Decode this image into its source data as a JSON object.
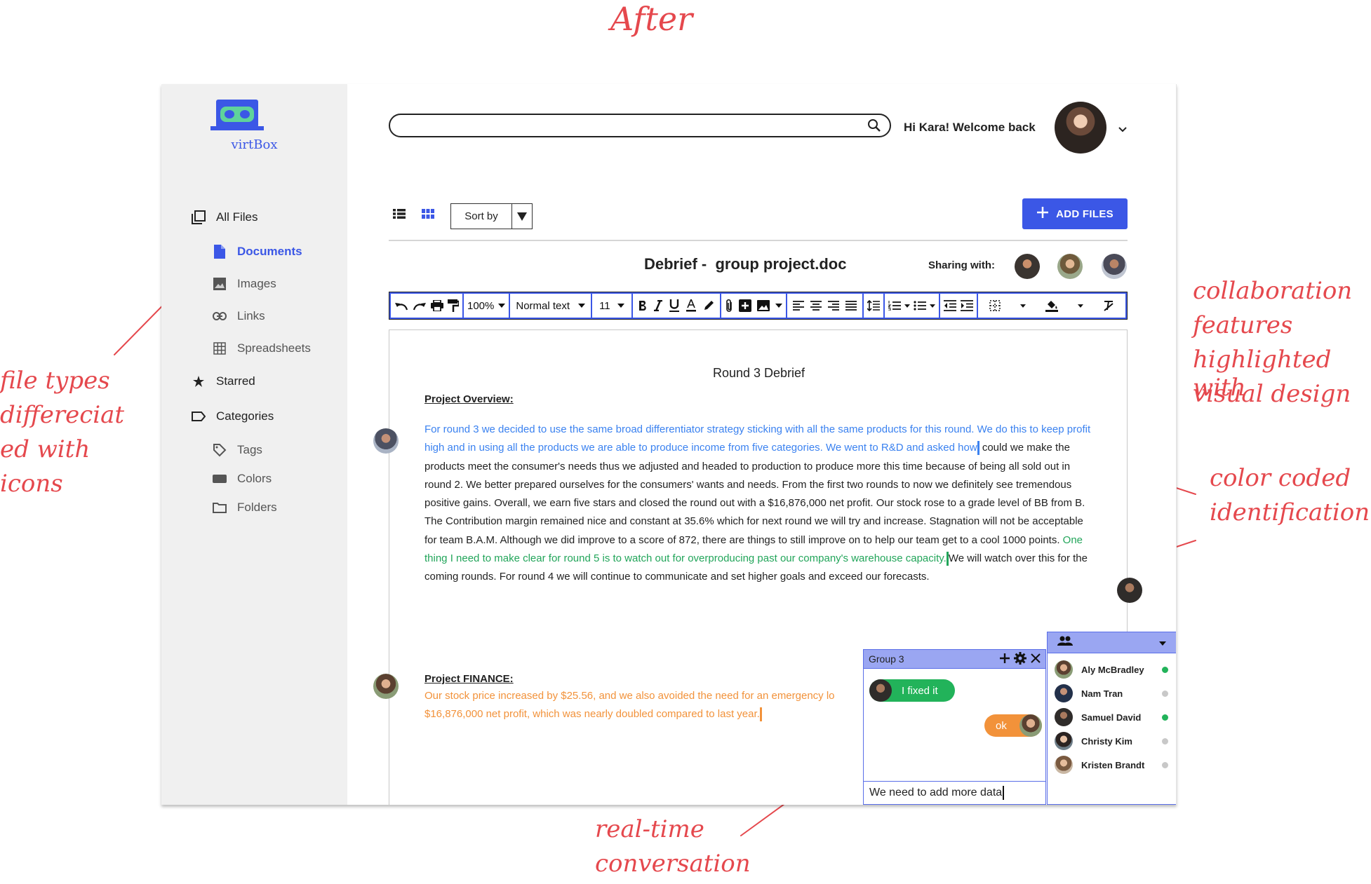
{
  "annotations": {
    "title": "After",
    "file_types": [
      "file types",
      "differeciat",
      "ed with",
      "icons"
    ],
    "collaboration": [
      "collaboration",
      "features",
      "highlighted with",
      "visual design"
    ],
    "color_coded": [
      "color coded",
      "identification"
    ],
    "realtime": [
      "real-time",
      "conversation"
    ]
  },
  "brand": {
    "name": "virtBox",
    "accent": "#3b57e6"
  },
  "sidebar": {
    "all_files": "All Files",
    "documents": "Documents",
    "images": "Images",
    "links": "Links",
    "spreadsheets": "Spreadsheets",
    "starred": "Starred",
    "categories": "Categories",
    "tags": "Tags",
    "colors": "Colors",
    "folders": "Folders"
  },
  "header": {
    "search_placeholder": "",
    "greeting": "Hi Kara! Welcome back"
  },
  "toolbar": {
    "sort_label": "Sort by",
    "add_files": "ADD FILES"
  },
  "document": {
    "title": "Debrief -  group project.doc",
    "sharing_label": "Sharing with:",
    "editor": {
      "zoom": "100%",
      "style": "Normal text",
      "font_size": "11"
    },
    "heading": "Round 3 Debrief",
    "overview_heading": "Project Overview:",
    "overview_blue": "For round 3 we decided to use the same broad differentiator strategy sticking with all the same products for this round. We do this to keep profit high and in using all the products we are able to produce income from five categories. We went to R&D and asked how",
    "overview_plain": " could we make the products meet the consumer's needs thus we adjusted and headed to production to produce more this time because of being all sold out in round 2. We better prepared ourselves for the consumers' wants and needs. From the first two rounds to now we definitely see tremendous positive gains. Overall, we earn five stars and closed the round out with a $16,876,000 net profit. Our stock rose to a grade level of BB from B. The Contribution margin remained nice and constant at 35.6% which for next round we will try and increase. Stagnation will not be acceptable for team B.A.M. Although we did improve to a score of 872, there are things to still improve on to help our team get to a cool 1000 points. ",
    "overview_green": "One thing I need to make clear for round 5 is to watch out for overproducing past our company's warehouse capacity.",
    "overview_tail": "We will watch over this for the coming rounds. For round 4 we will continue to communicate and set higher goals and exceed our forecasts.",
    "finance_heading": "Project FINANCE:",
    "finance_orange_1": "Our stock price increased by $25.56, and we also avoided the need for an emergency lo",
    "finance_orange_2": "$16,876,000 net profit, which was nearly doubled compared to last year."
  },
  "chat": {
    "title": "Group 3",
    "msg_1": "I fixed it",
    "msg_2": "ok",
    "input_value": "We need to add more data"
  },
  "members": [
    {
      "name": "Aly McBradley",
      "online": true
    },
    {
      "name": "Nam Tran",
      "online": false
    },
    {
      "name": "Samuel David",
      "online": true
    },
    {
      "name": "Christy Kim",
      "online": false
    },
    {
      "name": "Kristen Brandt",
      "online": false
    }
  ],
  "colors": {
    "online": "#22b35a",
    "offline": "#c8c8c8",
    "blue_author": "#3b82f0",
    "green_author": "#22a55a",
    "orange_author": "#f2923a"
  }
}
